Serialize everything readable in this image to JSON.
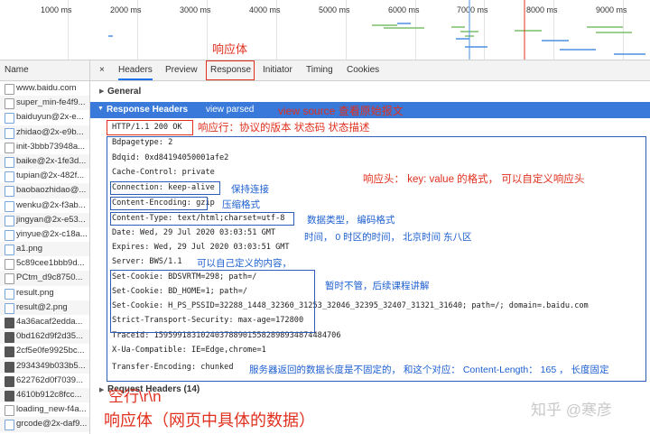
{
  "timeline": {
    "ticks": [
      "1000 ms",
      "2000 ms",
      "3000 ms",
      "4000 ms",
      "5000 ms",
      "6000 ms",
      "7000 ms",
      "8000 ms",
      "9000 ms"
    ]
  },
  "sidebar": {
    "header": "Name",
    "items": [
      {
        "label": "www.baidu.com",
        "icon": "document-icon"
      },
      {
        "label": "super_min-fe4f9...",
        "icon": "document-icon"
      },
      {
        "label": "baiduyun@2x-e...",
        "icon": "image-icon"
      },
      {
        "label": "zhidao@2x-e9b...",
        "icon": "image-icon"
      },
      {
        "label": "init-3bbb73948a...",
        "icon": "document-icon"
      },
      {
        "label": "baike@2x-1fe3d...",
        "icon": "image-icon"
      },
      {
        "label": "tupian@2x-482f...",
        "icon": "image-icon"
      },
      {
        "label": "baobaozhidao@...",
        "icon": "image-icon"
      },
      {
        "label": "wenku@2x-f3ab...",
        "icon": "image-icon"
      },
      {
        "label": "jingyan@2x-e53...",
        "icon": "image-icon"
      },
      {
        "label": "yinyue@2x-c18a...",
        "icon": "image-icon"
      },
      {
        "label": "a1.png",
        "icon": "image-icon"
      },
      {
        "label": "5c89cee1bbb9d...",
        "icon": "document-icon"
      },
      {
        "label": "PCtm_d9c8750...",
        "icon": "document-icon"
      },
      {
        "label": "result.png",
        "icon": "image-icon"
      },
      {
        "label": "result@2.png",
        "icon": "image-icon"
      },
      {
        "label": "4a36acaf2edda...",
        "icon": "dark-image-icon"
      },
      {
        "label": "0bd162d9f2d35...",
        "icon": "dark-image-icon"
      },
      {
        "label": "2cf5e0fe9925bc...",
        "icon": "dark-image-icon"
      },
      {
        "label": "2934349b033b5...",
        "icon": "dark-image-icon"
      },
      {
        "label": "622762d0f7039...",
        "icon": "dark-image-icon"
      },
      {
        "label": "4610b912c8fcc...",
        "icon": "dark-image-icon"
      },
      {
        "label": "loading_new-f4a...",
        "icon": "document-icon"
      },
      {
        "label": "grcode@2x-daf9...",
        "icon": "image-icon"
      }
    ]
  },
  "tabs": {
    "close": "×",
    "items": [
      "Headers",
      "Preview",
      "Response",
      "Initiator",
      "Timing",
      "Cookies"
    ],
    "active": "Headers"
  },
  "annotations_top": {
    "response_body_label": "响应体"
  },
  "general": "General",
  "response_headers": {
    "title": "Response Headers",
    "view_parsed": "view parsed",
    "view_source_note": "view source 查看原始报文"
  },
  "status_line": "HTTP/1.1 200 OK",
  "status_note": "响应行：协议的版本  状态码  状态描述",
  "headers": [
    "Bdpagetype: 2",
    "Bdqid: 0xd84194050001afe2",
    "Cache-Control: private",
    "Connection: keep-alive",
    "Content-Encoding: gzip",
    "Content-Type: text/html;charset=utf-8",
    "Date: Wed, 29 Jul 2020 03:03:51 GMT",
    "Expires: Wed, 29 Jul 2020 03:03:51 GMT",
    "Server: BWS/1.1",
    "Set-Cookie: BDSVRTM=298; path=/",
    "Set-Cookie: BD_HOME=1; path=/",
    "Set-Cookie: H_PS_PSSID=32288_1448_32360_31253_32046_32395_32407_31321_31640; path=/; domain=.baidu.com",
    "Strict-Transport-Security: max-age=172800",
    "Traceid: 1595991831024037889015582898934874484706",
    "X-Ua-Compatible: IE=Edge,chrome=1",
    "Transfer-Encoding: chunked"
  ],
  "notes": {
    "header_format": "响应头：  key: value 的格式，  可以自定义响应头",
    "keep_alive": "保持连接",
    "gzip": "压缩格式",
    "content_type": "数据类型，  编码格式",
    "date": "时间，  0 时区的时间，  北京时间 东八区",
    "server": "可以自己定义的内容，",
    "cookies": "暂时不管，后续课程讲解",
    "transfer": "服务器返回的数据长度是不固定的，  和这个对应：  Content-Length： 165 ，  长度固定"
  },
  "request_headers": "Request Headers (14)",
  "blank_line_note": "空行\\r\\n",
  "body_note": "响应体（网页中具体的数据）",
  "watermark": "知乎 @寒彦",
  "colors": {
    "accent": "#3879d9",
    "annotation_red": "#e0301e",
    "annotation_blue": "#1d5fd0"
  }
}
